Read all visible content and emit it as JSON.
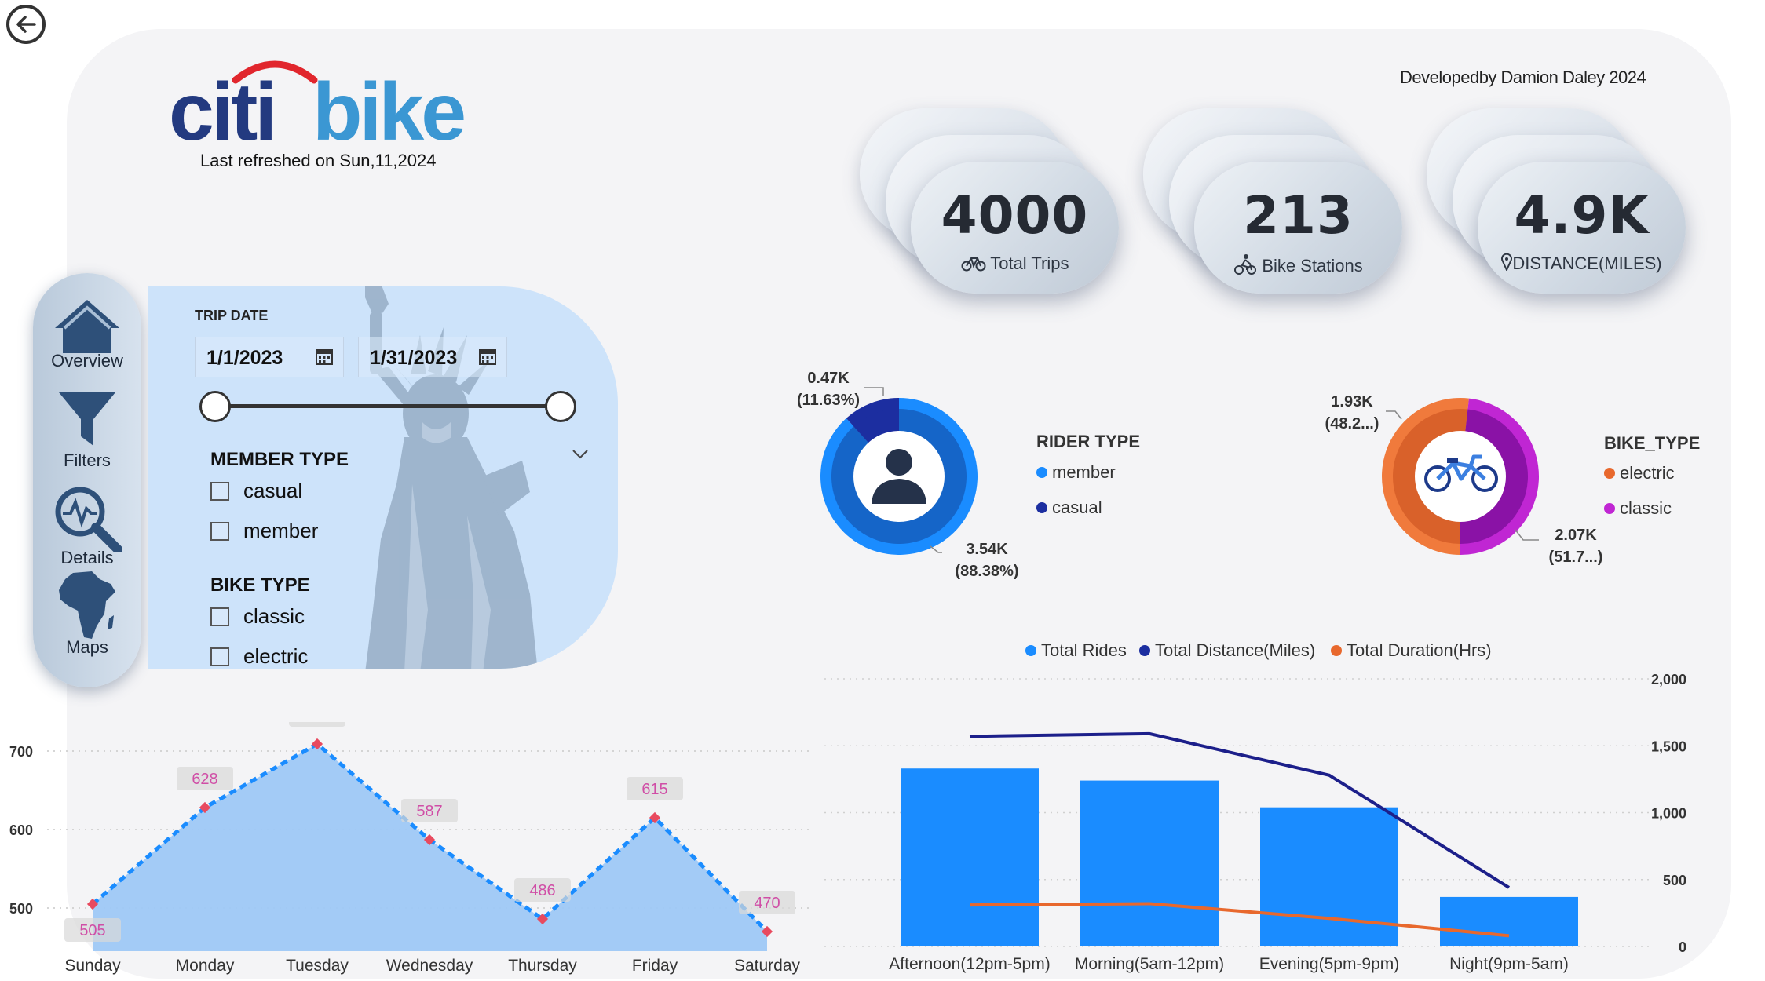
{
  "header": {
    "logo_text_a": "citi",
    "logo_text_b": "bike",
    "refreshed": "Last refreshed on Sun,11,2024",
    "developer": "Developedby Damion Daley 2024"
  },
  "kpis": [
    {
      "value": "4000",
      "label": "Total Trips",
      "icon": "bicycle-icon"
    },
    {
      "value": "213",
      "label": "Bike Stations",
      "icon": "cyclist-icon"
    },
    {
      "value": "4.9K",
      "label": "DISTANCE(MILES)",
      "icon": "map-pin-icon"
    }
  ],
  "nav": [
    {
      "label": "Overview",
      "icon": "home-icon"
    },
    {
      "label": "Filters",
      "icon": "funnel-icon"
    },
    {
      "label": "Details",
      "icon": "magnifier-pulse-icon"
    },
    {
      "label": "Maps",
      "icon": "africa-map-icon"
    }
  ],
  "filters": {
    "trip_date_label": "TRIP DATE",
    "start_date": "1/1/2023",
    "end_date": "1/31/2023",
    "member_type_label": "MEMBER TYPE",
    "member_options": [
      "casual",
      "member"
    ],
    "bike_type_label": "BIKE TYPE",
    "bike_options": [
      "classic",
      "electric"
    ]
  },
  "colors": {
    "member": "#1a8cff",
    "casual": "#1c2ea0",
    "electric": "#e8682d",
    "classic": "#c026d3",
    "rides": "#1a8cff",
    "distance": "#1c1f8a",
    "duration": "#e8682d",
    "area_fill": "#9ec8f5"
  },
  "chart_data": [
    {
      "type": "pie",
      "title": "RIDER TYPE",
      "labels": [
        "member",
        "casual"
      ],
      "values": [
        3540,
        470
      ],
      "data_labels": [
        {
          "value": "3.54K",
          "pct": "(88.38%)"
        },
        {
          "value": "0.47K",
          "pct": "(11.63%)"
        }
      ]
    },
    {
      "type": "pie",
      "title": "BIKE_TYPE",
      "labels": [
        "electric",
        "classic"
      ],
      "values": [
        2070,
        1930
      ],
      "data_labels": [
        {
          "value": "2.07K",
          "pct": "(51.7...)"
        },
        {
          "value": "1.93K",
          "pct": "(48.2...)"
        }
      ]
    },
    {
      "type": "area",
      "categories": [
        "Sunday",
        "Monday",
        "Tuesday",
        "Wednesday",
        "Thursday",
        "Friday",
        "Saturday"
      ],
      "values": [
        505,
        628,
        709,
        587,
        486,
        615,
        470
      ],
      "y_ticks": [
        "700",
        "600",
        "500"
      ],
      "ylim": [
        440,
        720
      ],
      "grid": true
    },
    {
      "type": "bar",
      "categories": [
        "Afternoon(12pm-5pm)",
        "Morning(5am-12pm)",
        "Evening(5pm-9pm)",
        "Night(9pm-5am)"
      ],
      "series": [
        {
          "name": "Total Rides",
          "kind": "bar",
          "values": [
            1330,
            1240,
            1040,
            370
          ]
        },
        {
          "name": "Total Distance(Miles)",
          "kind": "line",
          "values": [
            1570,
            1590,
            1280,
            440
          ]
        },
        {
          "name": "Total Duration(Hrs)",
          "kind": "line",
          "values": [
            310,
            320,
            210,
            80
          ]
        }
      ],
      "y_ticks": [
        "2,000",
        "1,500",
        "1,000",
        "500",
        "0"
      ],
      "ylim": [
        0,
        2000
      ],
      "legend_position": "top"
    }
  ]
}
